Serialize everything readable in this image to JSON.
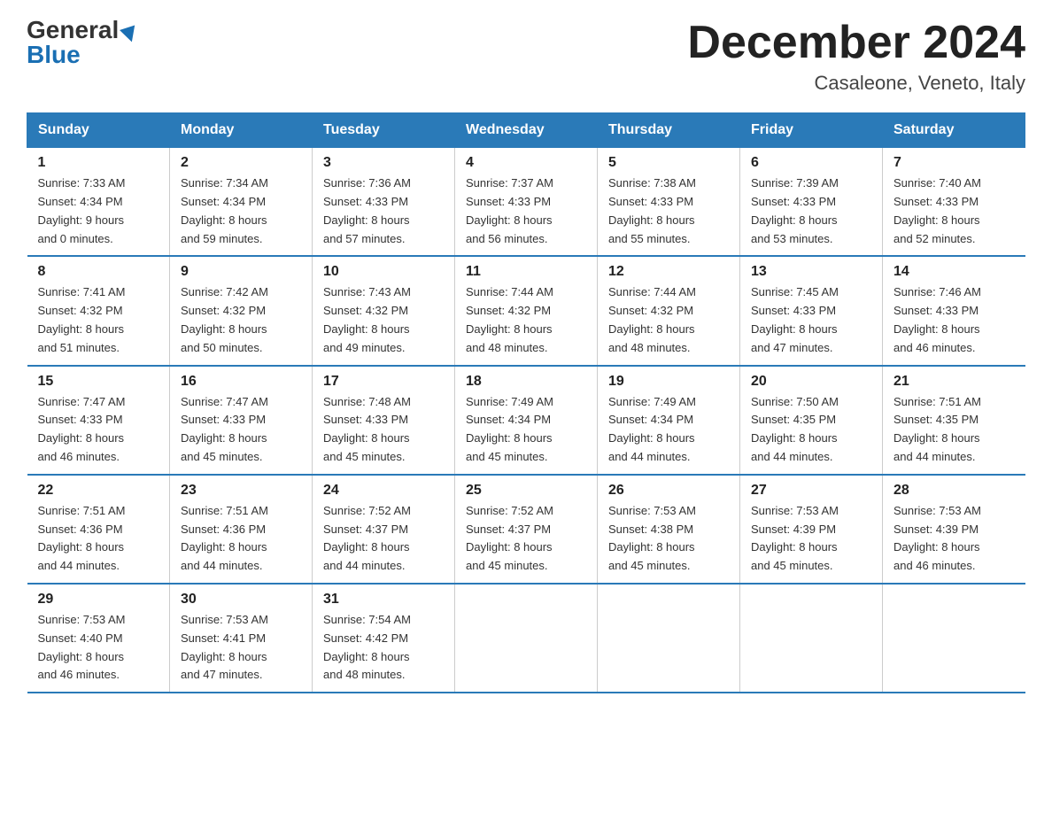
{
  "logo": {
    "general": "General",
    "blue": "Blue"
  },
  "header": {
    "month": "December 2024",
    "location": "Casaleone, Veneto, Italy"
  },
  "days_of_week": [
    "Sunday",
    "Monday",
    "Tuesday",
    "Wednesday",
    "Thursday",
    "Friday",
    "Saturday"
  ],
  "weeks": [
    [
      {
        "day": "1",
        "sunrise": "7:33 AM",
        "sunset": "4:34 PM",
        "daylight": "9 hours and 0 minutes."
      },
      {
        "day": "2",
        "sunrise": "7:34 AM",
        "sunset": "4:34 PM",
        "daylight": "8 hours and 59 minutes."
      },
      {
        "day": "3",
        "sunrise": "7:36 AM",
        "sunset": "4:33 PM",
        "daylight": "8 hours and 57 minutes."
      },
      {
        "day": "4",
        "sunrise": "7:37 AM",
        "sunset": "4:33 PM",
        "daylight": "8 hours and 56 minutes."
      },
      {
        "day": "5",
        "sunrise": "7:38 AM",
        "sunset": "4:33 PM",
        "daylight": "8 hours and 55 minutes."
      },
      {
        "day": "6",
        "sunrise": "7:39 AM",
        "sunset": "4:33 PM",
        "daylight": "8 hours and 53 minutes."
      },
      {
        "day": "7",
        "sunrise": "7:40 AM",
        "sunset": "4:33 PM",
        "daylight": "8 hours and 52 minutes."
      }
    ],
    [
      {
        "day": "8",
        "sunrise": "7:41 AM",
        "sunset": "4:32 PM",
        "daylight": "8 hours and 51 minutes."
      },
      {
        "day": "9",
        "sunrise": "7:42 AM",
        "sunset": "4:32 PM",
        "daylight": "8 hours and 50 minutes."
      },
      {
        "day": "10",
        "sunrise": "7:43 AM",
        "sunset": "4:32 PM",
        "daylight": "8 hours and 49 minutes."
      },
      {
        "day": "11",
        "sunrise": "7:44 AM",
        "sunset": "4:32 PM",
        "daylight": "8 hours and 48 minutes."
      },
      {
        "day": "12",
        "sunrise": "7:44 AM",
        "sunset": "4:32 PM",
        "daylight": "8 hours and 48 minutes."
      },
      {
        "day": "13",
        "sunrise": "7:45 AM",
        "sunset": "4:33 PM",
        "daylight": "8 hours and 47 minutes."
      },
      {
        "day": "14",
        "sunrise": "7:46 AM",
        "sunset": "4:33 PM",
        "daylight": "8 hours and 46 minutes."
      }
    ],
    [
      {
        "day": "15",
        "sunrise": "7:47 AM",
        "sunset": "4:33 PM",
        "daylight": "8 hours and 46 minutes."
      },
      {
        "day": "16",
        "sunrise": "7:47 AM",
        "sunset": "4:33 PM",
        "daylight": "8 hours and 45 minutes."
      },
      {
        "day": "17",
        "sunrise": "7:48 AM",
        "sunset": "4:33 PM",
        "daylight": "8 hours and 45 minutes."
      },
      {
        "day": "18",
        "sunrise": "7:49 AM",
        "sunset": "4:34 PM",
        "daylight": "8 hours and 45 minutes."
      },
      {
        "day": "19",
        "sunrise": "7:49 AM",
        "sunset": "4:34 PM",
        "daylight": "8 hours and 44 minutes."
      },
      {
        "day": "20",
        "sunrise": "7:50 AM",
        "sunset": "4:35 PM",
        "daylight": "8 hours and 44 minutes."
      },
      {
        "day": "21",
        "sunrise": "7:51 AM",
        "sunset": "4:35 PM",
        "daylight": "8 hours and 44 minutes."
      }
    ],
    [
      {
        "day": "22",
        "sunrise": "7:51 AM",
        "sunset": "4:36 PM",
        "daylight": "8 hours and 44 minutes."
      },
      {
        "day": "23",
        "sunrise": "7:51 AM",
        "sunset": "4:36 PM",
        "daylight": "8 hours and 44 minutes."
      },
      {
        "day": "24",
        "sunrise": "7:52 AM",
        "sunset": "4:37 PM",
        "daylight": "8 hours and 44 minutes."
      },
      {
        "day": "25",
        "sunrise": "7:52 AM",
        "sunset": "4:37 PM",
        "daylight": "8 hours and 45 minutes."
      },
      {
        "day": "26",
        "sunrise": "7:53 AM",
        "sunset": "4:38 PM",
        "daylight": "8 hours and 45 minutes."
      },
      {
        "day": "27",
        "sunrise": "7:53 AM",
        "sunset": "4:39 PM",
        "daylight": "8 hours and 45 minutes."
      },
      {
        "day": "28",
        "sunrise": "7:53 AM",
        "sunset": "4:39 PM",
        "daylight": "8 hours and 46 minutes."
      }
    ],
    [
      {
        "day": "29",
        "sunrise": "7:53 AM",
        "sunset": "4:40 PM",
        "daylight": "8 hours and 46 minutes."
      },
      {
        "day": "30",
        "sunrise": "7:53 AM",
        "sunset": "4:41 PM",
        "daylight": "8 hours and 47 minutes."
      },
      {
        "day": "31",
        "sunrise": "7:54 AM",
        "sunset": "4:42 PM",
        "daylight": "8 hours and 48 minutes."
      },
      null,
      null,
      null,
      null
    ]
  ],
  "labels": {
    "sunrise": "Sunrise:",
    "sunset": "Sunset:",
    "daylight": "Daylight:"
  }
}
